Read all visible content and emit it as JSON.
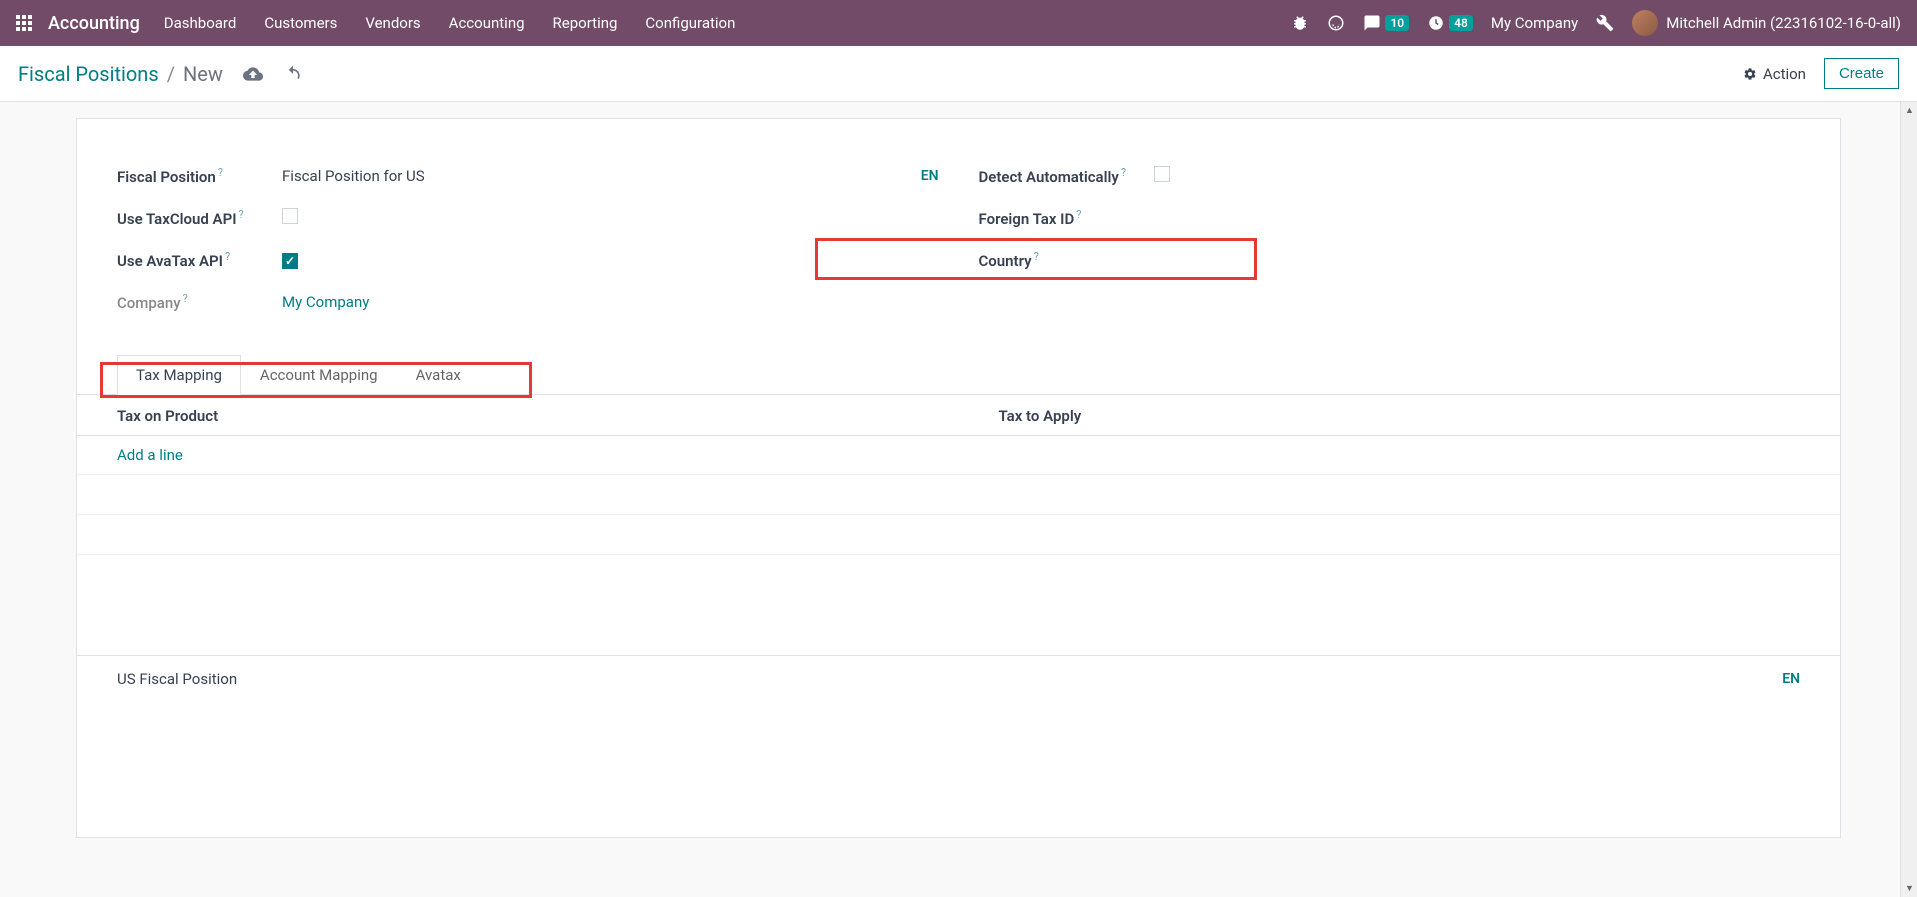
{
  "navbar": {
    "brand": "Accounting",
    "menu": [
      "Dashboard",
      "Customers",
      "Vendors",
      "Accounting",
      "Reporting",
      "Configuration"
    ],
    "messages_badge": "10",
    "activities_badge": "48",
    "company": "My Company",
    "user": "Mitchell Admin (22316102-16-0-all)"
  },
  "breadcrumb": {
    "parent": "Fiscal Positions",
    "current": "New"
  },
  "controls": {
    "action_label": "Action",
    "create_label": "Create"
  },
  "form": {
    "fiscal_position_label": "Fiscal Position",
    "fiscal_position_value": "Fiscal Position for US",
    "use_taxcloud_label": "Use TaxCloud API",
    "use_taxcloud_checked": false,
    "use_avatax_label": "Use AvaTax API",
    "use_avatax_checked": true,
    "company_label": "Company",
    "company_value": "My Company",
    "detect_auto_label": "Detect Automatically",
    "detect_auto_checked": false,
    "foreign_tax_label": "Foreign Tax ID",
    "foreign_tax_value": "",
    "country_label": "Country",
    "country_value": "",
    "lang_badge": "EN"
  },
  "tabs": {
    "items": [
      "Tax Mapping",
      "Account Mapping",
      "Avatax"
    ],
    "active_index": 0
  },
  "table": {
    "col1": "Tax on Product",
    "col2": "Tax to Apply",
    "add_line": "Add a line"
  },
  "notes": {
    "text": "US Fiscal Position",
    "lang": "EN"
  }
}
